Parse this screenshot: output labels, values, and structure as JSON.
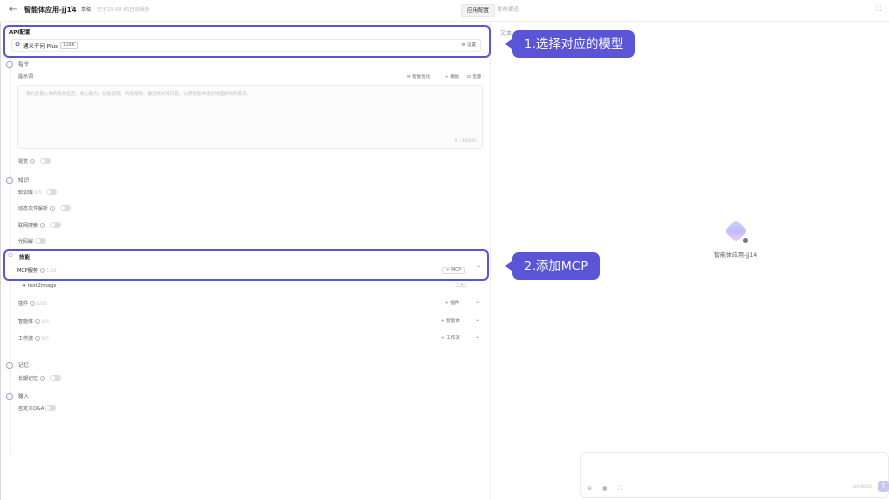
{
  "header": {
    "back_icon": "arrow-left-icon",
    "title": "智能体应用-jj14",
    "draft": "草稿",
    "save_status": "已于23:48:45自动保存",
    "tabs": [
      {
        "label": "应用配置",
        "active": true
      },
      {
        "label": "发布渠道",
        "active": false
      }
    ]
  },
  "api": {
    "section_label": "API配置",
    "model_name": "通义千问 Plus",
    "context_tag": "128K",
    "settings_label": "设置"
  },
  "instructions": {
    "section_label": "指令",
    "prompt_label": "提示词",
    "optimize_label": "智能优化",
    "template_label": "模板",
    "variable_label": "变量",
    "prompt_placeholder": "请在此输入你的角色设定、核心能力、技能说明、约束限制、输出格式等内容，以便智能体更好地理解你的需求。",
    "prompt_counter": "0 / 30000",
    "vision_label": "视觉"
  },
  "knowledge": {
    "section_label": "知识",
    "rows": [
      {
        "label": "知识库",
        "hint": "0/5"
      },
      {
        "label": "动态文件解析",
        "hint": ""
      },
      {
        "label": "联网搜索",
        "hint": ""
      },
      {
        "label": "代码解",
        "hint": ""
      }
    ]
  },
  "skills": {
    "section_label": "技能",
    "mcp_label": "MCP服务",
    "mcp_count": "1/20",
    "mcp_add": "+ MCP",
    "mcp_item": "text2image",
    "mcp_item_tag": "工具2",
    "rows": [
      {
        "label": "插件",
        "hint": "0/20",
        "add": "+ 插件"
      },
      {
        "label": "智能体",
        "hint": "0/5",
        "add": "+ 智能体"
      },
      {
        "label": "工作流",
        "hint": "0/5",
        "add": "+ 工作流"
      }
    ]
  },
  "memory": {
    "section_label": "记忆",
    "long_term_label": "长期记忆"
  },
  "output": {
    "section_label": "输入",
    "qa_label": "自定义Q&A"
  },
  "callouts": {
    "step1": "1.选择对应的模型",
    "step2": "2.添加MCP"
  },
  "preview": {
    "header": "文本",
    "agent_name": "智能体应用-jj14",
    "char_count": "0/10000"
  },
  "colors": {
    "accent": "#5a55d6",
    "send": "#c7c7f0"
  }
}
